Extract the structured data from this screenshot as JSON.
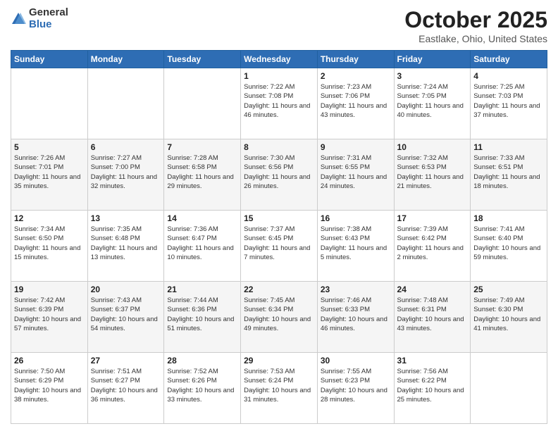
{
  "logo": {
    "general": "General",
    "blue": "Blue"
  },
  "title": {
    "month": "October 2025",
    "location": "Eastlake, Ohio, United States"
  },
  "weekdays": [
    "Sunday",
    "Monday",
    "Tuesday",
    "Wednesday",
    "Thursday",
    "Friday",
    "Saturday"
  ],
  "weeks": [
    [
      {
        "day": "",
        "sunrise": "",
        "sunset": "",
        "daylight": ""
      },
      {
        "day": "",
        "sunrise": "",
        "sunset": "",
        "daylight": ""
      },
      {
        "day": "",
        "sunrise": "",
        "sunset": "",
        "daylight": ""
      },
      {
        "day": "1",
        "sunrise": "Sunrise: 7:22 AM",
        "sunset": "Sunset: 7:08 PM",
        "daylight": "Daylight: 11 hours and 46 minutes."
      },
      {
        "day": "2",
        "sunrise": "Sunrise: 7:23 AM",
        "sunset": "Sunset: 7:06 PM",
        "daylight": "Daylight: 11 hours and 43 minutes."
      },
      {
        "day": "3",
        "sunrise": "Sunrise: 7:24 AM",
        "sunset": "Sunset: 7:05 PM",
        "daylight": "Daylight: 11 hours and 40 minutes."
      },
      {
        "day": "4",
        "sunrise": "Sunrise: 7:25 AM",
        "sunset": "Sunset: 7:03 PM",
        "daylight": "Daylight: 11 hours and 37 minutes."
      }
    ],
    [
      {
        "day": "5",
        "sunrise": "Sunrise: 7:26 AM",
        "sunset": "Sunset: 7:01 PM",
        "daylight": "Daylight: 11 hours and 35 minutes."
      },
      {
        "day": "6",
        "sunrise": "Sunrise: 7:27 AM",
        "sunset": "Sunset: 7:00 PM",
        "daylight": "Daylight: 11 hours and 32 minutes."
      },
      {
        "day": "7",
        "sunrise": "Sunrise: 7:28 AM",
        "sunset": "Sunset: 6:58 PM",
        "daylight": "Daylight: 11 hours and 29 minutes."
      },
      {
        "day": "8",
        "sunrise": "Sunrise: 7:30 AM",
        "sunset": "Sunset: 6:56 PM",
        "daylight": "Daylight: 11 hours and 26 minutes."
      },
      {
        "day": "9",
        "sunrise": "Sunrise: 7:31 AM",
        "sunset": "Sunset: 6:55 PM",
        "daylight": "Daylight: 11 hours and 24 minutes."
      },
      {
        "day": "10",
        "sunrise": "Sunrise: 7:32 AM",
        "sunset": "Sunset: 6:53 PM",
        "daylight": "Daylight: 11 hours and 21 minutes."
      },
      {
        "day": "11",
        "sunrise": "Sunrise: 7:33 AM",
        "sunset": "Sunset: 6:51 PM",
        "daylight": "Daylight: 11 hours and 18 minutes."
      }
    ],
    [
      {
        "day": "12",
        "sunrise": "Sunrise: 7:34 AM",
        "sunset": "Sunset: 6:50 PM",
        "daylight": "Daylight: 11 hours and 15 minutes."
      },
      {
        "day": "13",
        "sunrise": "Sunrise: 7:35 AM",
        "sunset": "Sunset: 6:48 PM",
        "daylight": "Daylight: 11 hours and 13 minutes."
      },
      {
        "day": "14",
        "sunrise": "Sunrise: 7:36 AM",
        "sunset": "Sunset: 6:47 PM",
        "daylight": "Daylight: 11 hours and 10 minutes."
      },
      {
        "day": "15",
        "sunrise": "Sunrise: 7:37 AM",
        "sunset": "Sunset: 6:45 PM",
        "daylight": "Daylight: 11 hours and 7 minutes."
      },
      {
        "day": "16",
        "sunrise": "Sunrise: 7:38 AM",
        "sunset": "Sunset: 6:43 PM",
        "daylight": "Daylight: 11 hours and 5 minutes."
      },
      {
        "day": "17",
        "sunrise": "Sunrise: 7:39 AM",
        "sunset": "Sunset: 6:42 PM",
        "daylight": "Daylight: 11 hours and 2 minutes."
      },
      {
        "day": "18",
        "sunrise": "Sunrise: 7:41 AM",
        "sunset": "Sunset: 6:40 PM",
        "daylight": "Daylight: 10 hours and 59 minutes."
      }
    ],
    [
      {
        "day": "19",
        "sunrise": "Sunrise: 7:42 AM",
        "sunset": "Sunset: 6:39 PM",
        "daylight": "Daylight: 10 hours and 57 minutes."
      },
      {
        "day": "20",
        "sunrise": "Sunrise: 7:43 AM",
        "sunset": "Sunset: 6:37 PM",
        "daylight": "Daylight: 10 hours and 54 minutes."
      },
      {
        "day": "21",
        "sunrise": "Sunrise: 7:44 AM",
        "sunset": "Sunset: 6:36 PM",
        "daylight": "Daylight: 10 hours and 51 minutes."
      },
      {
        "day": "22",
        "sunrise": "Sunrise: 7:45 AM",
        "sunset": "Sunset: 6:34 PM",
        "daylight": "Daylight: 10 hours and 49 minutes."
      },
      {
        "day": "23",
        "sunrise": "Sunrise: 7:46 AM",
        "sunset": "Sunset: 6:33 PM",
        "daylight": "Daylight: 10 hours and 46 minutes."
      },
      {
        "day": "24",
        "sunrise": "Sunrise: 7:48 AM",
        "sunset": "Sunset: 6:31 PM",
        "daylight": "Daylight: 10 hours and 43 minutes."
      },
      {
        "day": "25",
        "sunrise": "Sunrise: 7:49 AM",
        "sunset": "Sunset: 6:30 PM",
        "daylight": "Daylight: 10 hours and 41 minutes."
      }
    ],
    [
      {
        "day": "26",
        "sunrise": "Sunrise: 7:50 AM",
        "sunset": "Sunset: 6:29 PM",
        "daylight": "Daylight: 10 hours and 38 minutes."
      },
      {
        "day": "27",
        "sunrise": "Sunrise: 7:51 AM",
        "sunset": "Sunset: 6:27 PM",
        "daylight": "Daylight: 10 hours and 36 minutes."
      },
      {
        "day": "28",
        "sunrise": "Sunrise: 7:52 AM",
        "sunset": "Sunset: 6:26 PM",
        "daylight": "Daylight: 10 hours and 33 minutes."
      },
      {
        "day": "29",
        "sunrise": "Sunrise: 7:53 AM",
        "sunset": "Sunset: 6:24 PM",
        "daylight": "Daylight: 10 hours and 31 minutes."
      },
      {
        "day": "30",
        "sunrise": "Sunrise: 7:55 AM",
        "sunset": "Sunset: 6:23 PM",
        "daylight": "Daylight: 10 hours and 28 minutes."
      },
      {
        "day": "31",
        "sunrise": "Sunrise: 7:56 AM",
        "sunset": "Sunset: 6:22 PM",
        "daylight": "Daylight: 10 hours and 25 minutes."
      },
      {
        "day": "",
        "sunrise": "",
        "sunset": "",
        "daylight": ""
      }
    ]
  ]
}
